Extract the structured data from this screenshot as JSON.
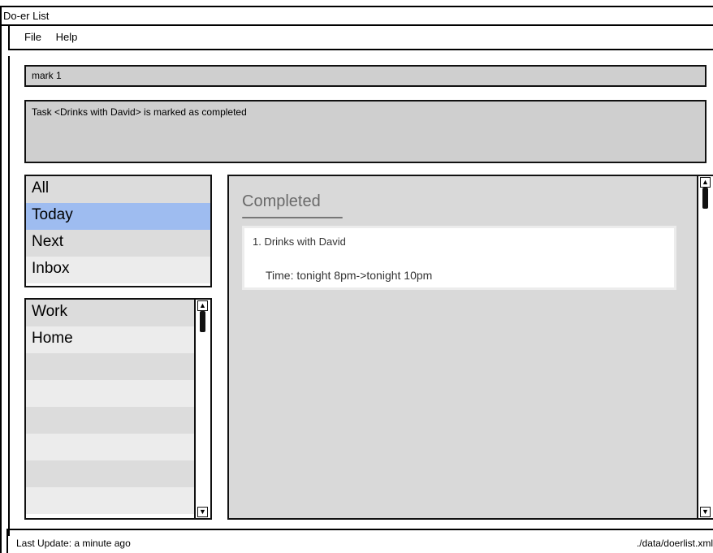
{
  "window": {
    "title": "Do-er List"
  },
  "menu": {
    "file": "File",
    "help": "Help"
  },
  "command": {
    "value": "mark 1"
  },
  "result": {
    "message": "Task <Drinks with David> is marked as completed"
  },
  "categories": {
    "items": [
      "All",
      "Today",
      "Next",
      "Inbox"
    ],
    "selected": "Today"
  },
  "tags": {
    "items": [
      "Work",
      "Home"
    ]
  },
  "tasks": {
    "section_title": "Completed",
    "items": [
      {
        "name": "1. Drinks with David",
        "time": "Time: tonight 8pm->tonight 10pm"
      }
    ]
  },
  "status": {
    "last_update": "Last Update: a minute ago",
    "file_path": "./data/doerlist.xml"
  },
  "colors": {
    "selected_row": "#9ebcf0",
    "panel_bg": "#d9d9d9",
    "box_bg": "#cfcfcf"
  }
}
